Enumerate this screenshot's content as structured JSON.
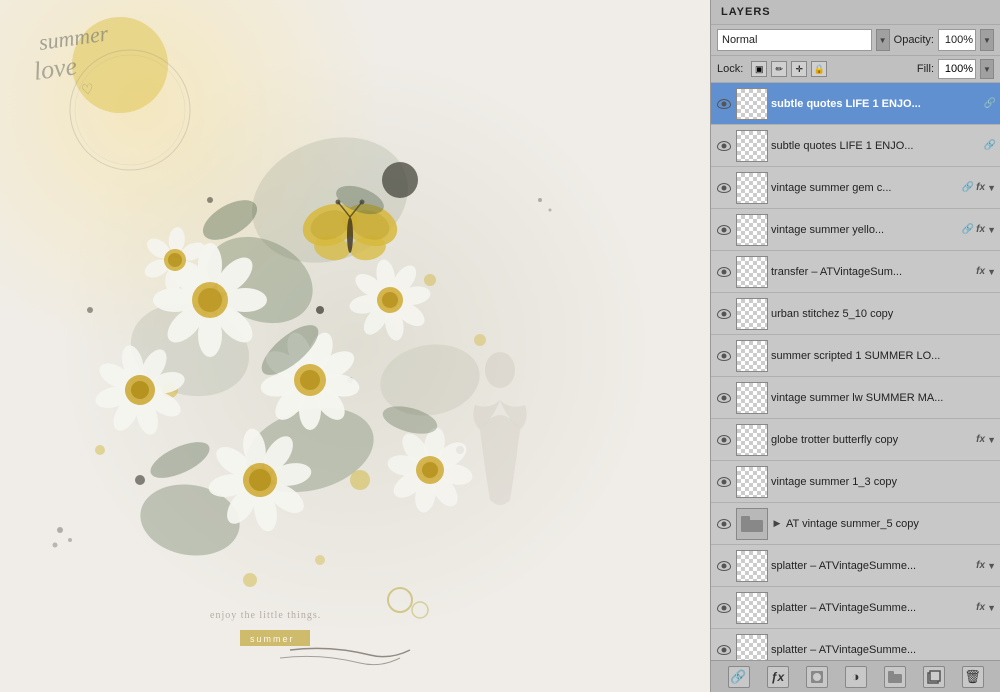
{
  "panel": {
    "title": "LAYERS",
    "blend_mode": "Normal",
    "opacity_label": "Opacity:",
    "opacity_value": "100%",
    "lock_label": "Lock:",
    "fill_label": "Fill:",
    "fill_value": "100%"
  },
  "canvas": {
    "text_top_line1": "summer",
    "text_top_line2": "love",
    "text_bottom": "enjoy the little things.",
    "text_banner": "summer"
  },
  "layers": [
    {
      "id": 0,
      "name": "subtle quotes LIFE 1 ENJO...",
      "link": true,
      "fx": false,
      "selected": true,
      "visible": true,
      "is_group": false
    },
    {
      "id": 1,
      "name": "subtle quotes LIFE 1 ENJO...",
      "link": true,
      "fx": false,
      "selected": false,
      "visible": true,
      "is_group": false
    },
    {
      "id": 2,
      "name": "vintage summer gem c...",
      "link": true,
      "fx": true,
      "selected": false,
      "visible": true,
      "is_group": false
    },
    {
      "id": 3,
      "name": "vintage summer yello...",
      "link": true,
      "fx": true,
      "selected": false,
      "visible": true,
      "is_group": false
    },
    {
      "id": 4,
      "name": "transfer – ATVintageSum...",
      "link": false,
      "fx": true,
      "selected": false,
      "visible": true,
      "is_group": false
    },
    {
      "id": 5,
      "name": "urban stitchez 5_10 copy",
      "link": false,
      "fx": false,
      "selected": false,
      "visible": true,
      "is_group": false
    },
    {
      "id": 6,
      "name": "summer scripted 1 SUMMER LO...",
      "link": false,
      "fx": false,
      "selected": false,
      "visible": true,
      "is_group": false
    },
    {
      "id": 7,
      "name": "vintage summer lw SUMMER MA...",
      "link": false,
      "fx": false,
      "selected": false,
      "visible": true,
      "is_group": false
    },
    {
      "id": 8,
      "name": "globe trotter butterfly copy",
      "link": false,
      "fx": true,
      "selected": false,
      "visible": true,
      "is_group": false
    },
    {
      "id": 9,
      "name": "vintage summer 1_3 copy",
      "link": false,
      "fx": false,
      "selected": false,
      "visible": true,
      "is_group": false
    },
    {
      "id": 10,
      "name": "AT vintage summer_5 copy",
      "link": false,
      "fx": false,
      "selected": false,
      "visible": true,
      "is_group": true
    },
    {
      "id": 11,
      "name": "splatter – ATVintageSumme...",
      "link": false,
      "fx": true,
      "selected": false,
      "visible": true,
      "is_group": false
    },
    {
      "id": 12,
      "name": "splatter – ATVintageSumme...",
      "link": false,
      "fx": true,
      "selected": false,
      "visible": true,
      "is_group": false
    },
    {
      "id": 13,
      "name": "splatter – ATVintageSumme...",
      "link": false,
      "fx": false,
      "selected": false,
      "visible": true,
      "is_group": false
    }
  ],
  "bottom_buttons": [
    {
      "id": "link",
      "icon": "🔗",
      "label": "link-layers-button"
    },
    {
      "id": "fx",
      "icon": "ƒx",
      "label": "add-fx-button"
    },
    {
      "id": "mask",
      "icon": "⬜",
      "label": "add-mask-button"
    },
    {
      "id": "adjustment",
      "icon": "◑",
      "label": "add-adjustment-button"
    },
    {
      "id": "folder",
      "icon": "📁",
      "label": "new-group-button"
    },
    {
      "id": "new",
      "icon": "📄",
      "label": "new-layer-button"
    },
    {
      "id": "delete",
      "icon": "🗑",
      "label": "delete-layer-button"
    }
  ]
}
